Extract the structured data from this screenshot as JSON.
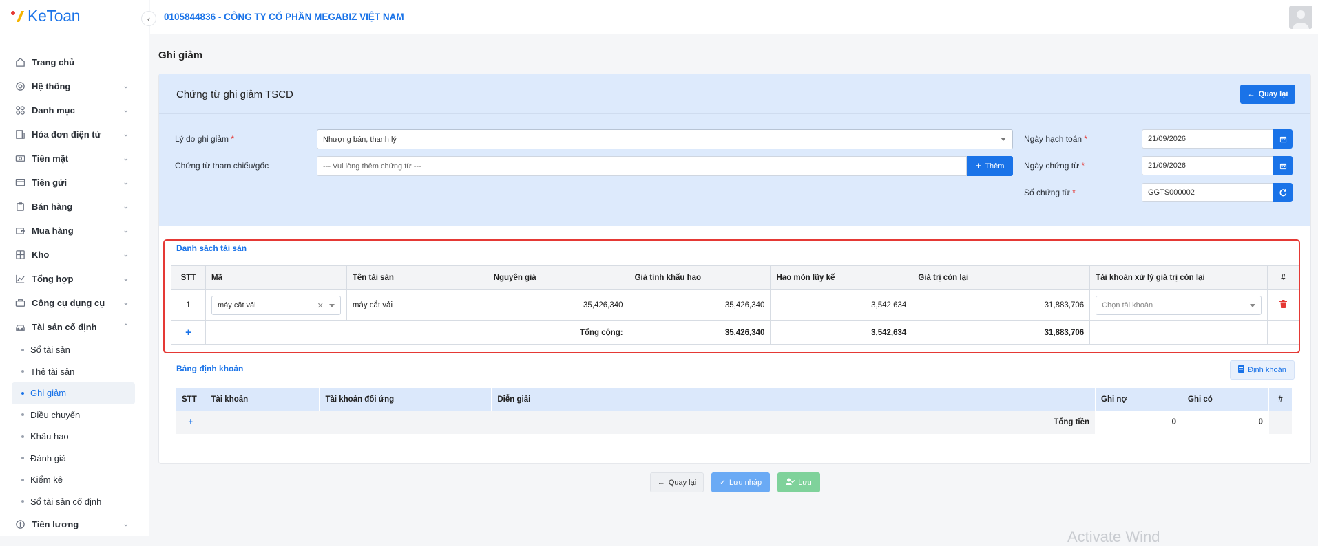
{
  "app": {
    "brand": "KeToan",
    "company": "0105844836 - CÔNG TY CỔ PHẦN MEGABIZ VIỆT NAM"
  },
  "sidebar": {
    "items": [
      {
        "label": "Trang chủ",
        "icon": "home-icon"
      },
      {
        "label": "Hệ thống",
        "icon": "gear-icon"
      },
      {
        "label": "Danh mục",
        "icon": "grid-icon"
      },
      {
        "label": "Hóa đơn điện tử",
        "icon": "invoice-icon"
      },
      {
        "label": "Tiền mặt",
        "icon": "cash-icon"
      },
      {
        "label": "Tiền gửi",
        "icon": "card-icon"
      },
      {
        "label": "Bán hàng",
        "icon": "sales-icon"
      },
      {
        "label": "Mua hàng",
        "icon": "wallet-icon"
      },
      {
        "label": "Kho",
        "icon": "warehouse-icon"
      },
      {
        "label": "Tổng hợp",
        "icon": "chart-icon"
      },
      {
        "label": "Công cụ dụng cụ",
        "icon": "tools-icon"
      },
      {
        "label": "Tài sản cố định",
        "icon": "car-icon"
      }
    ],
    "sub_items": [
      "Sổ tài sản",
      "Thẻ tài sản",
      "Ghi giảm",
      "Điều chuyển",
      "Khấu hao",
      "Đánh giá",
      "Kiểm kê",
      "Sổ tài sản cố định"
    ],
    "last_item": {
      "label": "Tiền lương",
      "icon": "salary-icon"
    }
  },
  "page": {
    "title": "Ghi giảm"
  },
  "card": {
    "title": "Chứng từ ghi giảm TSCD",
    "back_label": "Quay lại"
  },
  "form": {
    "reason_label": "Lý do ghi giảm",
    "reason_value": "Nhượng bán, thanh lý",
    "ref_label": "Chứng từ tham chiếu/gốc",
    "ref_placeholder": "--- Vui lòng thêm chứng từ ---",
    "add_label": "Thêm",
    "posting_date_label": "Ngày hạch toán",
    "posting_date": "21/09/2026",
    "doc_date_label": "Ngày chứng từ",
    "doc_date": "21/09/2026",
    "doc_no_label": "Số chứng từ",
    "doc_no": "GGTS000002",
    "required_mark": "*"
  },
  "assets": {
    "title": "Danh sách tài sản",
    "headers": [
      "STT",
      "Mã",
      "Tên tài sản",
      "Nguyên giá",
      "Giá tính khấu hao",
      "Hao mòn lũy kế",
      "Giá trị còn lại",
      "Tài khoản xử lý giá trị còn lại",
      "#"
    ],
    "row": {
      "stt": "1",
      "code": "máy cắt vải",
      "name": "máy cắt vải",
      "cost": "35,426,340",
      "depr_base": "35,426,340",
      "accum": "3,542,634",
      "remaining": "31,883,706",
      "account_placeholder": "Chọn tài khoản"
    },
    "total_label": "Tổng cộng:",
    "totals": {
      "cost": "35,426,340",
      "accum": "3,542,634",
      "remaining": "31,883,706"
    },
    "add_symbol": "+"
  },
  "accounting": {
    "title": "Bảng định khoản",
    "button_label": "Định khoản",
    "headers": [
      "STT",
      "Tài khoản",
      "Tài khoản đối ứng",
      "Diễn giải",
      "Ghi nợ",
      "Ghi có",
      "#"
    ],
    "total_label": "Tổng tiền",
    "debit_total": "0",
    "credit_total": "0",
    "add_symbol": "+"
  },
  "footer": {
    "back": "Quay lại",
    "draft": "Lưu nháp",
    "save": "Lưu"
  },
  "watermark": "Activate Wind",
  "colors": {
    "accent": "#1a73e8",
    "header_bg": "#ddeafc",
    "highlight": "#e53935",
    "draft_btn": "#6aaaf5",
    "save_btn": "#7fd29b"
  }
}
